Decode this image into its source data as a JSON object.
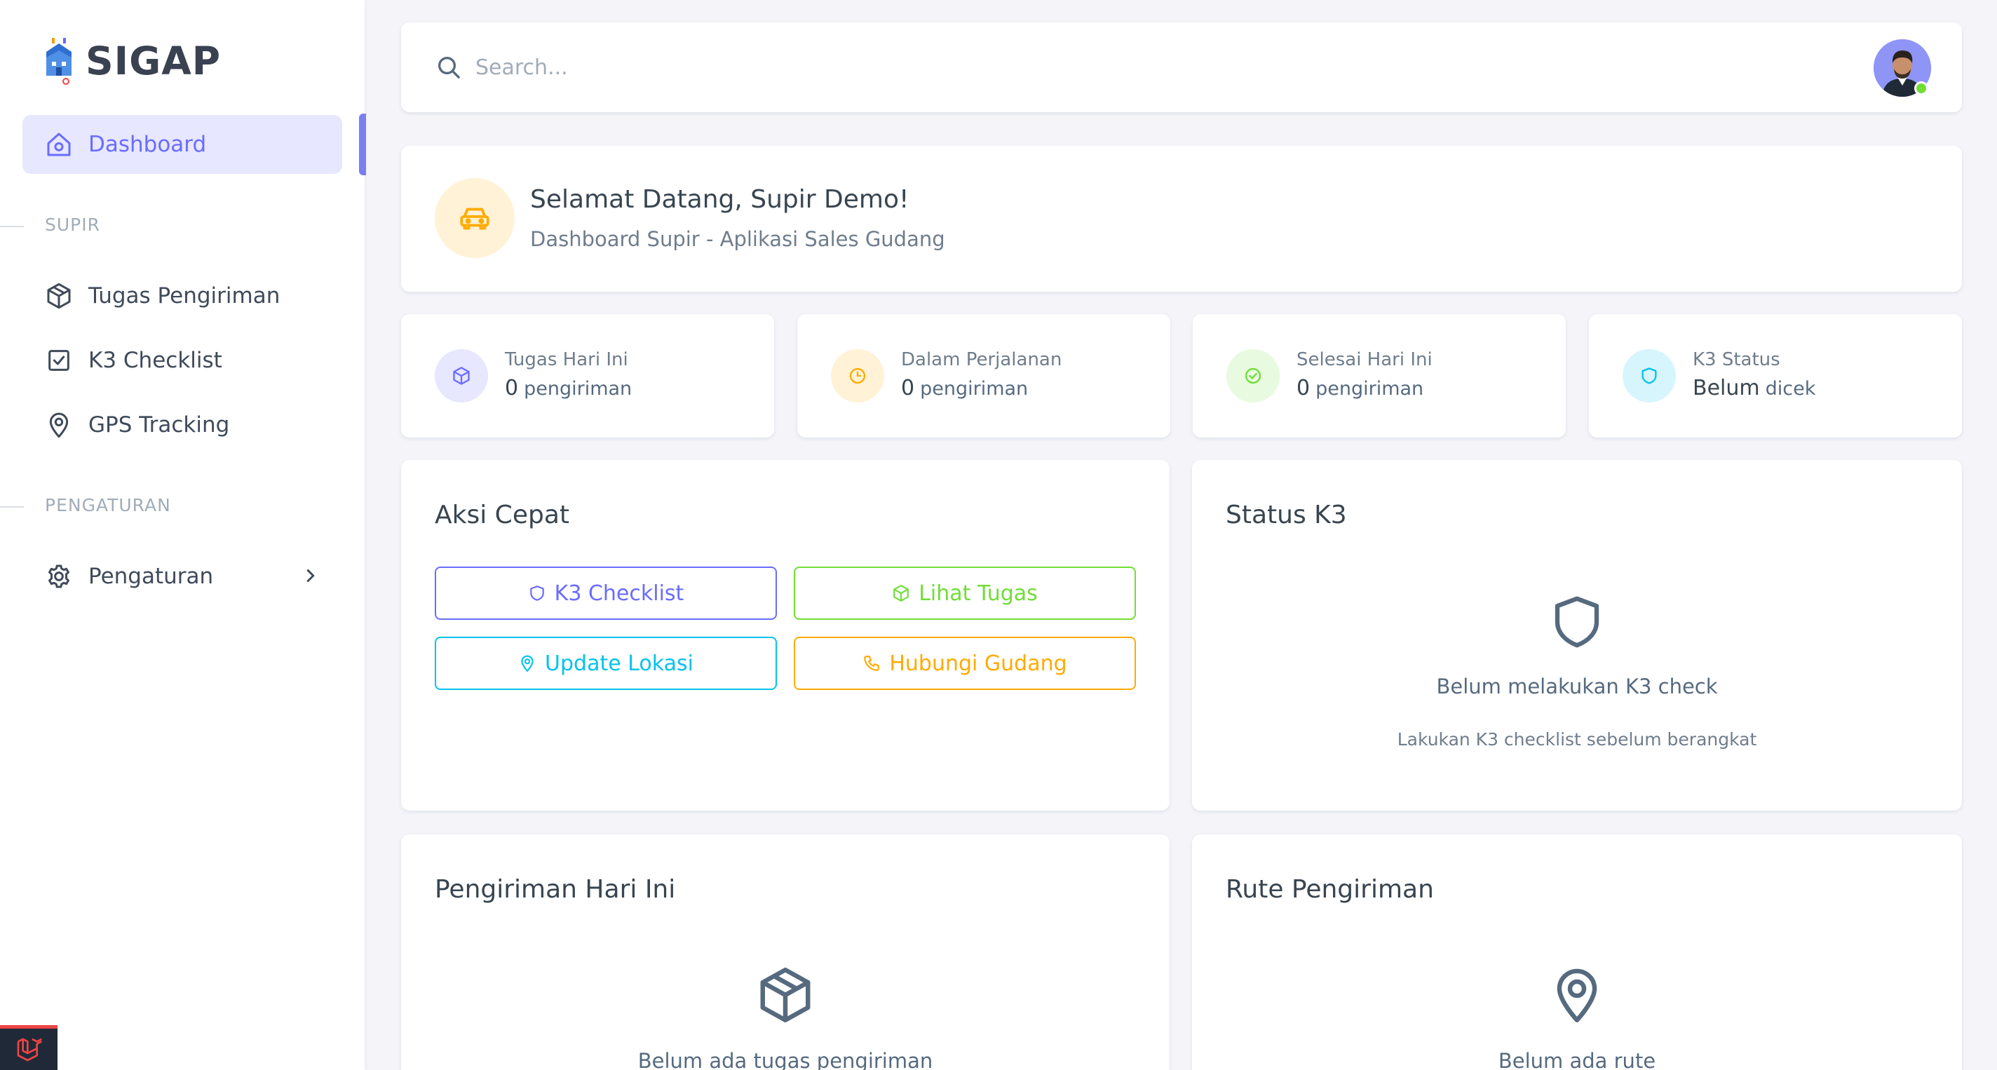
{
  "app": {
    "name": "SIGAP"
  },
  "sidebar": {
    "dashboard": {
      "label": "Dashboard",
      "icon": "home-icon"
    },
    "sections": [
      {
        "header": "SUPIR",
        "items": [
          {
            "label": "Tugas Pengiriman",
            "icon": "package-icon"
          },
          {
            "label": "K3 Checklist",
            "icon": "checkbox-icon"
          },
          {
            "label": "GPS Tracking",
            "icon": "map-pin-icon"
          }
        ]
      },
      {
        "header": "PENGATURAN",
        "items": [
          {
            "label": "Pengaturan",
            "icon": "gear-icon"
          }
        ]
      }
    ]
  },
  "topbar": {
    "search_placeholder": "Search...",
    "user_status": "online"
  },
  "welcome": {
    "title": "Selamat Datang, Supir Demo!",
    "subtitle": "Dashboard Supir - Aplikasi Sales Gudang",
    "icon": "car-icon"
  },
  "stats": [
    {
      "label": "Tugas Hari Ini",
      "value": "0",
      "unit": "pengiriman",
      "icon": "package-icon",
      "color": "#696cff",
      "bg": "#e7e7ff"
    },
    {
      "label": "Dalam Perjalanan",
      "value": "0",
      "unit": "pengiriman",
      "icon": "clock-icon",
      "color": "#ffab00",
      "bg": "#fff2d6"
    },
    {
      "label": "Selesai Hari Ini",
      "value": "0",
      "unit": "pengiriman",
      "icon": "check-circle-icon",
      "color": "#71dd37",
      "bg": "#e8fadf"
    },
    {
      "label": "K3 Status",
      "value": "Belum",
      "unit": "dicek",
      "icon": "shield-icon",
      "color": "#03c3ec",
      "bg": "#d7f5fc"
    }
  ],
  "quick_actions": {
    "title": "Aksi Cepat",
    "buttons": [
      {
        "label": "K3 Checklist",
        "icon": "shield-icon",
        "color": "#696cff"
      },
      {
        "label": "Lihat Tugas",
        "icon": "package-icon",
        "color": "#71dd37"
      },
      {
        "label": "Update Lokasi",
        "icon": "map-pin-icon",
        "color": "#03c3ec"
      },
      {
        "label": "Hubungi Gudang",
        "icon": "phone-icon",
        "color": "#ffab00"
      }
    ]
  },
  "k3_status": {
    "title": "Status K3",
    "empty_title": "Belum melakukan K3 check",
    "empty_subtitle": "Lakukan K3 checklist sebelum berangkat"
  },
  "shipments_today": {
    "title": "Pengiriman Hari Ini",
    "empty_title": "Belum ada tugas pengiriman"
  },
  "route": {
    "title": "Rute Pengiriman",
    "empty_title": "Belum ada rute"
  }
}
